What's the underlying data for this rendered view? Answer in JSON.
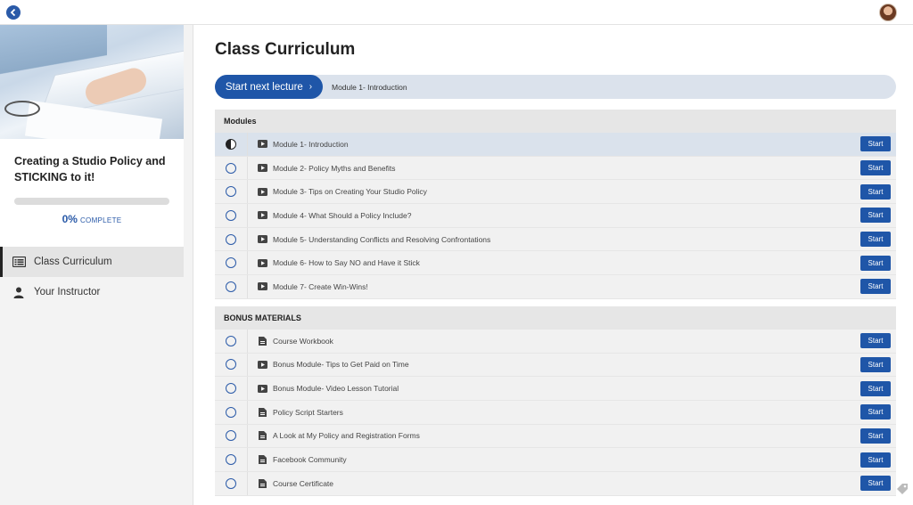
{
  "course": {
    "title": "Creating a Studio Policy and STICKING to it!",
    "progress_percent": 0,
    "progress_pct_text": "0%",
    "progress_label": "COMPLETE"
  },
  "nav": {
    "items": [
      {
        "label": "Class Curriculum",
        "icon": "curriculum-icon",
        "active": true
      },
      {
        "label": "Your Instructor",
        "icon": "person-icon",
        "active": false
      }
    ]
  },
  "main": {
    "title": "Class Curriculum",
    "next_button_label": "Start next lecture",
    "next_chevron": "›",
    "next_lecture": "Module 1- Introduction"
  },
  "sections": [
    {
      "title": "Modules",
      "rows": [
        {
          "title": "Module 1- Introduction",
          "type": "video",
          "state": "in-progress"
        },
        {
          "title": "Module 2- Policy Myths and Benefits",
          "type": "video",
          "state": "not-started"
        },
        {
          "title": "Module 3- Tips on Creating Your Studio Policy",
          "type": "video",
          "state": "not-started"
        },
        {
          "title": "Module 4- What Should a Policy Include?",
          "type": "video",
          "state": "not-started"
        },
        {
          "title": "Module 5- Understanding Conflicts and Resolving Confrontations",
          "type": "video",
          "state": "not-started"
        },
        {
          "title": "Module 6- How to Say NO and Have it Stick",
          "type": "video",
          "state": "not-started"
        },
        {
          "title": "Module 7- Create Win-Wins!",
          "type": "video",
          "state": "not-started"
        }
      ]
    },
    {
      "title": "BONUS MATERIALS",
      "rows": [
        {
          "title": "Course Workbook",
          "type": "document",
          "state": "not-started"
        },
        {
          "title": "Bonus Module- Tips to Get Paid on Time",
          "type": "video",
          "state": "not-started"
        },
        {
          "title": "Bonus Module- Video Lesson Tutorial",
          "type": "video",
          "state": "not-started"
        },
        {
          "title": "Policy Script Starters",
          "type": "document",
          "state": "not-started"
        },
        {
          "title": "A Look at My Policy and Registration Forms",
          "type": "document",
          "state": "not-started"
        },
        {
          "title": "Facebook Community",
          "type": "document",
          "state": "not-started"
        },
        {
          "title": "Course Certificate",
          "type": "document",
          "state": "not-started"
        }
      ]
    }
  ],
  "start_label": "Start",
  "colors": {
    "accent": "#1f56a8",
    "current_row": "#dae2ec",
    "row_bg": "#f1f1f1",
    "section_head": "#e6e6e6"
  }
}
